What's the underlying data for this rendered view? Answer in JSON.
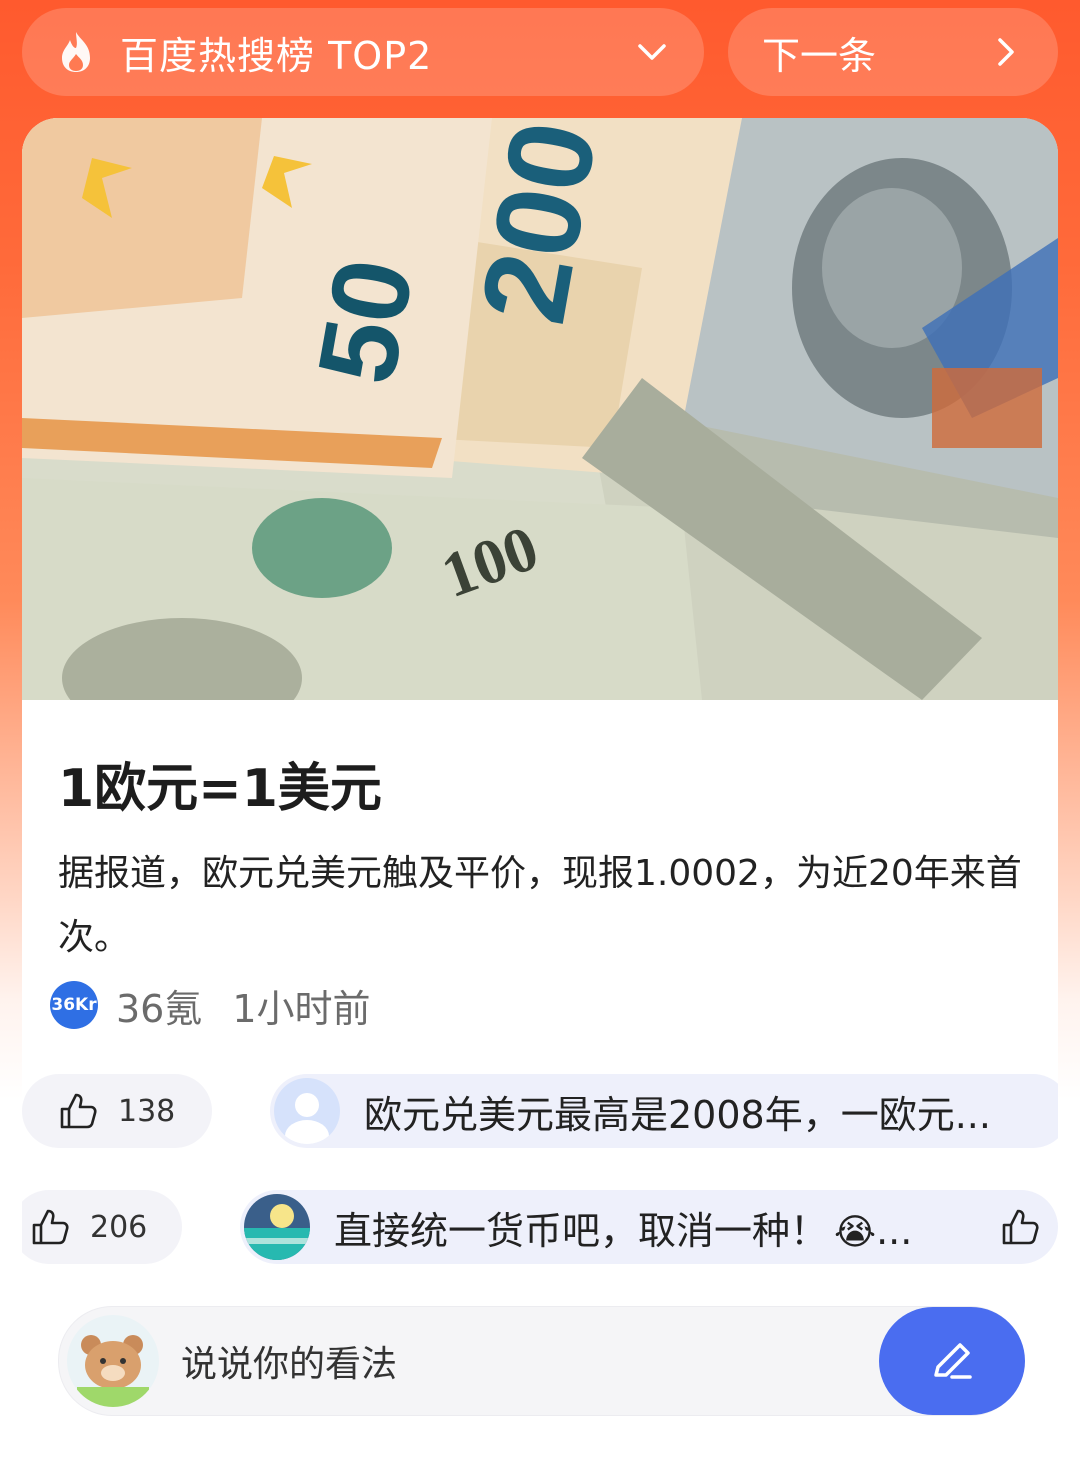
{
  "header": {
    "hotlist_label": "百度热搜榜 TOP2",
    "next_label": "下一条"
  },
  "article": {
    "title": "1欧元=1美元",
    "summary": "据报道，欧元兑美元触及平价，现报1.0002，为近20年来首次。",
    "source_logo_text": "36Kr",
    "source_name": "36氪",
    "time": "1小时前"
  },
  "comments": [
    {
      "like_count": "138",
      "text": "欧元兑美元最高是2008年，一欧元..."
    },
    {
      "like_count": "206",
      "text": "直接统一货币吧，取消一种！",
      "emoji": "😭",
      "ellipsis": "..."
    }
  ],
  "composer": {
    "placeholder": "说说你的看法"
  },
  "colors": {
    "header_gradient": "#ff5a2e",
    "write_button": "#4a6df0",
    "source_logo": "#2f6fe4"
  },
  "icons": [
    "flame-icon",
    "chevron-down-icon",
    "chevron-right-icon",
    "thumbs-up-icon",
    "edit-pencil-icon"
  ]
}
